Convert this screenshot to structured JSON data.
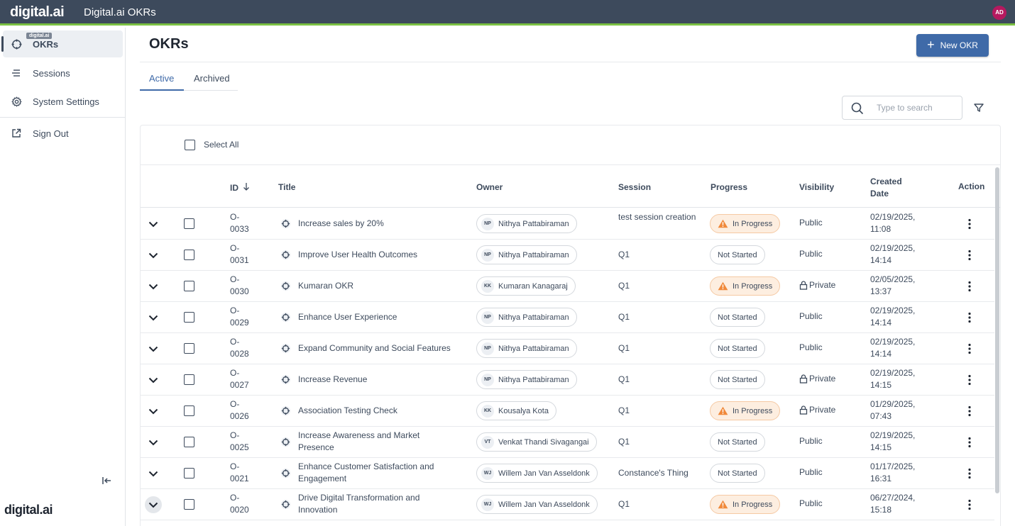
{
  "topbar": {
    "logo": "digital.ai",
    "title": "Digital.ai OKRs",
    "avatar": "AD"
  },
  "sidebar": {
    "tooltip": "digital.ai",
    "items": [
      {
        "label": "OKRs",
        "icon": "target-icon"
      },
      {
        "label": "Sessions",
        "icon": "list-icon"
      },
      {
        "label": "System Settings",
        "icon": "gear-icon"
      },
      {
        "label": "Sign Out",
        "icon": "external-link-icon"
      }
    ],
    "bottom_logo": "digital.ai"
  },
  "page": {
    "title": "OKRs",
    "new_button": "New OKR",
    "tabs": [
      "Active",
      "Archived"
    ],
    "search_placeholder": "Type to search",
    "select_all": "Select All"
  },
  "table": {
    "headers": {
      "id": "ID",
      "title": "Title",
      "owner": "Owner",
      "session": "Session",
      "progress": "Progress",
      "visibility": "Visibility",
      "created_l1": "Created",
      "created_l2": "Date",
      "action": "Action"
    },
    "rows": [
      {
        "id1": "O-",
        "id2": "0033",
        "title": "Increase sales by 20%",
        "ini": "NP",
        "owner": "Nithya Pattabiraman",
        "session": "test session creation",
        "progress": "In Progress",
        "visibility": "Public",
        "date1": "02/19/2025,",
        "date2": "11:08"
      },
      {
        "id1": "O-",
        "id2": "0031",
        "title": "Improve User Health Outcomes",
        "ini": "NP",
        "owner": "Nithya Pattabiraman",
        "session": "Q1",
        "progress": "Not Started",
        "visibility": "Public",
        "date1": "02/19/2025,",
        "date2": "14:14"
      },
      {
        "id1": "O-",
        "id2": "0030",
        "title": "Kumaran OKR",
        "ini": "KK",
        "owner": "Kumaran Kanagaraj",
        "session": "Q1",
        "progress": "In Progress",
        "visibility": "Private",
        "date1": "02/05/2025,",
        "date2": "13:37"
      },
      {
        "id1": "O-",
        "id2": "0029",
        "title": "Enhance User Experience",
        "ini": "NP",
        "owner": "Nithya Pattabiraman",
        "session": "Q1",
        "progress": "Not Started",
        "visibility": "Public",
        "date1": "02/19/2025,",
        "date2": "14:14"
      },
      {
        "id1": "O-",
        "id2": "0028",
        "title": "Expand Community and Social Features",
        "ini": "NP",
        "owner": "Nithya Pattabiraman",
        "session": "Q1",
        "progress": "Not Started",
        "visibility": "Public",
        "date1": "02/19/2025,",
        "date2": "14:14"
      },
      {
        "id1": "O-",
        "id2": "0027",
        "title": "Increase Revenue",
        "ini": "NP",
        "owner": "Nithya Pattabiraman",
        "session": "Q1",
        "progress": "Not Started",
        "visibility": "Private",
        "date1": "02/19/2025,",
        "date2": "14:15"
      },
      {
        "id1": "O-",
        "id2": "0026",
        "title": "Association Testing Check",
        "ini": "KK",
        "owner": "Kousalya Kota",
        "session": "Q1",
        "progress": "In Progress",
        "visibility": "Private",
        "date1": "01/29/2025,",
        "date2": "07:43"
      },
      {
        "id1": "O-",
        "id2": "0025",
        "title": "Increase Awareness and Market Presence",
        "ini": "VT",
        "owner": "Venkat Thandi Sivagangai",
        "session": "Q1",
        "progress": "Not Started",
        "visibility": "Public",
        "date1": "02/19/2025,",
        "date2": "14:15"
      },
      {
        "id1": "O-",
        "id2": "0021",
        "title": "Enhance Customer Satisfaction and Engagement",
        "ini": "WJ",
        "owner": "Willem Jan Van Asseldonk",
        "session": "Constance's Thing",
        "progress": "Not Started",
        "visibility": "Public",
        "date1": "01/17/2025,",
        "date2": "16:31"
      },
      {
        "id1": "O-",
        "id2": "0020",
        "title": "Drive Digital Transformation and Innovation",
        "ini": "WJ",
        "owner": "Willem Jan Van Asseldonk",
        "session": "Q1",
        "progress": "In Progress",
        "visibility": "Public",
        "date1": "06/27/2024,",
        "date2": "15:18"
      }
    ]
  },
  "colors": {
    "topbar": "#3d4a5c",
    "accent_green": "#7bc142",
    "primary": "#3f6aa8",
    "in_progress_bg": "#fdeee0",
    "warning": "#f0893a",
    "avatar": "#b5195f"
  }
}
